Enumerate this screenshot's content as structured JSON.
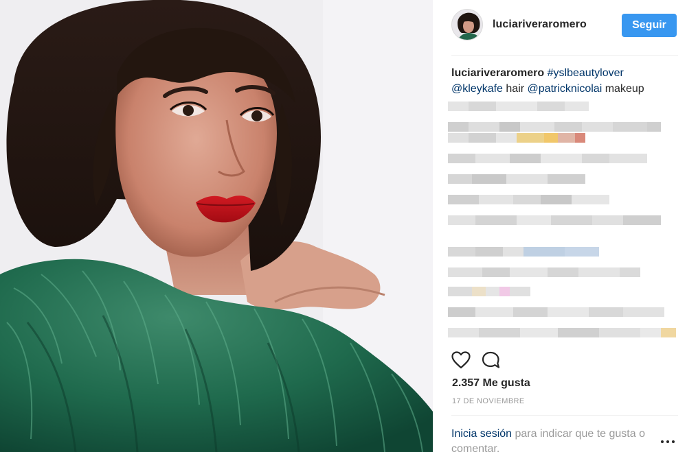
{
  "post": {
    "username": "luciariveraromero",
    "follow_label": "Seguir",
    "caption": {
      "username": "luciariveraromero",
      "hashtag": "#yslbeautylover",
      "mention_hair": "@kleykafe",
      "hair_text": "hair",
      "mention_makeup": "@patricknicolai",
      "makeup_text": "makeup"
    },
    "likes_text": "2.357 Me gusta",
    "date_text": "17 DE NOVIEMBRE",
    "login_prompt": {
      "link": "Inicia sesión",
      "rest": "para indicar que te gusta o comentar."
    },
    "icons": {
      "like": "heart-icon",
      "comment": "comment-icon",
      "more": "more-options-icon"
    }
  },
  "colors": {
    "follow_button": "#3897f0",
    "link": "#003569",
    "muted_text": "#999999",
    "body_text": "#262626",
    "divider": "#efefef"
  }
}
